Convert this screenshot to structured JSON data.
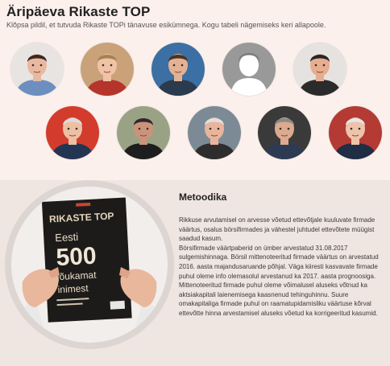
{
  "header": {
    "title": "Äripäeva Rikaste TOP",
    "subtitle": "Klõpsa pildil, et tutvuda Rikaste TOPi tänavuse esikümnega. Kogu tabeli nägemiseks keri allapoole."
  },
  "avatars_row1": [
    {
      "icon": "person-photo-icon",
      "bg": "#e8e4e2",
      "skin": "#e9b8a0",
      "hair": "#3b2a22",
      "shirt": "#6d8fc0"
    },
    {
      "icon": "person-photo-icon",
      "bg": "#c9a27a",
      "skin": "#f0c3a6",
      "hair": "#a5834f",
      "shirt": "#b5352d"
    },
    {
      "icon": "person-photo-icon",
      "bg": "#3c6fa3",
      "skin": "#e3b292",
      "hair": "#4a3322",
      "shirt": "#2b3a4c"
    },
    {
      "icon": "person-placeholder-icon",
      "bg": "#999999",
      "skin": "#ffffff",
      "hair": "#ffffff",
      "shirt": "#ffffff"
    },
    {
      "icon": "person-photo-icon",
      "bg": "#e6e2df",
      "skin": "#e6ad90",
      "hair": "#252525",
      "shirt": "#2b2b2b"
    }
  ],
  "avatars_row2": [
    {
      "icon": "person-photo-icon",
      "bg": "#d33b2d",
      "skin": "#edc0a4",
      "hair": "#dcdcdc",
      "shirt": "#233553"
    },
    {
      "icon": "person-photo-icon",
      "bg": "#9aa286",
      "skin": "#c99479",
      "hair": "#2a2a2a",
      "shirt": "#1e1e1e"
    },
    {
      "icon": "person-photo-icon",
      "bg": "#7c8a95",
      "skin": "#e8b59c",
      "hair": "#e0e0e0",
      "shirt": "#2d2d2d"
    },
    {
      "icon": "person-photo-icon",
      "bg": "#3a3a3a",
      "skin": "#dcaa8f",
      "hair": "#8a8a8a",
      "shirt": "#2c3b52"
    },
    {
      "icon": "person-photo-icon",
      "bg": "#b43a34",
      "skin": "#eec3aa",
      "hair": "#e6e6e6",
      "shirt": "#1f2d45"
    }
  ],
  "magazine": {
    "brand": "RIKASTE TOP",
    "big_number": "500",
    "line1": "Eesti",
    "line2": "jõukamat",
    "line3": "inimest",
    "icon": "magazine-in-hands-icon"
  },
  "methodology": {
    "title": "Metoodika",
    "paragraphs": [
      "Rikkuse arvutamisel on arvesse võetud ettevõtjale kuuluvate firmade väärtus, osalus börsifirmades ja vähestel juhtudel ettevõtete müügist saadud kasum.",
      "Börsifirmade väärtpaberid on ümber arvestatud 31.08.2017 sulgemishinnaga. Börsil mittenoteeritud firmade väärtus on arvestatud 2016. aasta majandusaruande põhjal. Väga kiiresti kasvavate firmade puhul oleme info olemasolul arvestanud ka 2017. aasta prognoosiga.",
      "Mittenoteeritud firmade puhul oleme võimalusel aluseks võtnud ka aktsiakapitali laienemisega kaasnenud tehinguhinnu. Suure omakapitaliga firmade puhul on raamatupidamisliku väärtuse kõrval ettevõtte hinna arvestamisel aluseks võetud ka korrigeeritud kasumid."
    ]
  }
}
